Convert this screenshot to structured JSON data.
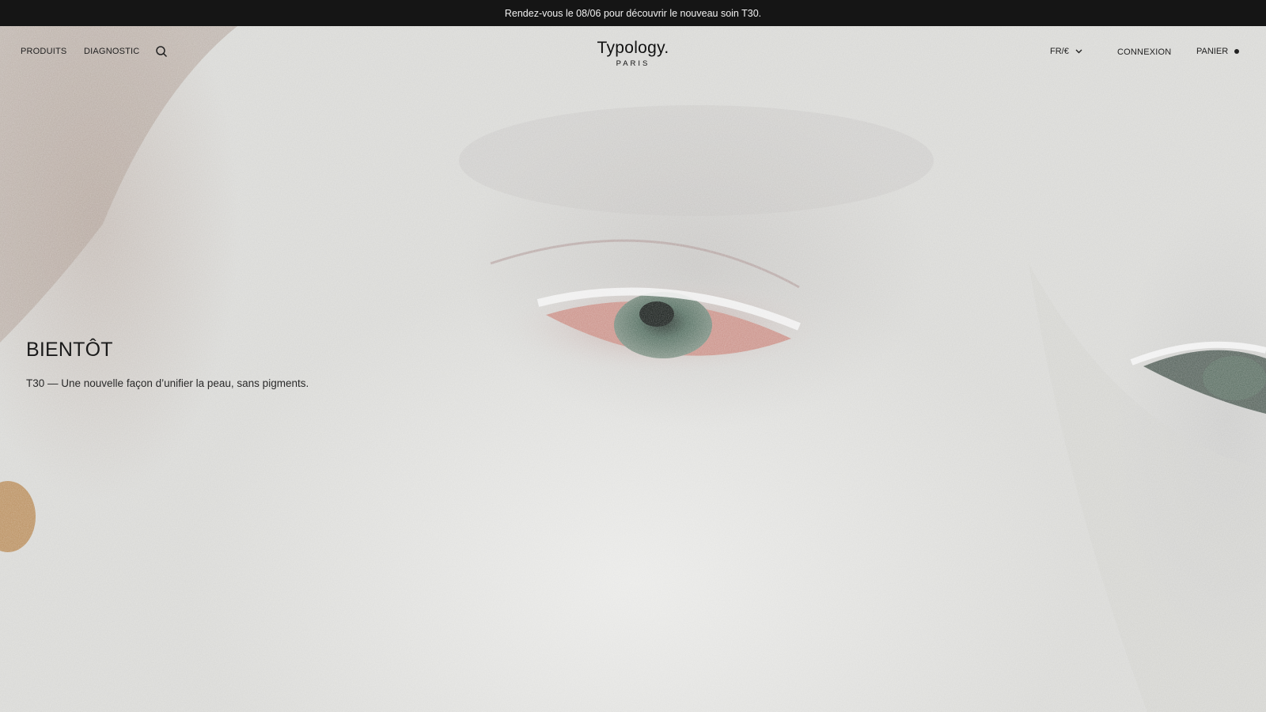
{
  "announcement": {
    "text": "Rendez-vous le 08/06 pour découvrir le nouveau soin T30."
  },
  "nav": {
    "left": [
      {
        "label": "PRODUITS"
      },
      {
        "label": "DIAGNOSTIC"
      }
    ],
    "search_icon": "search-icon",
    "logo": {
      "main": "Typology.",
      "sub": "PARIS"
    },
    "right": {
      "lang": "FR/€",
      "connexion": "CONNEXION",
      "panier": "PANIER"
    }
  },
  "hero": {
    "title": "BIENTÔT",
    "subtitle": "T30 — Une nouvelle façon d’unifier la peau, sans pigments."
  },
  "colors": {
    "announcement_bg": "#151515",
    "text": "#1a1a1a",
    "hero_bg": "#d9d9d6"
  }
}
